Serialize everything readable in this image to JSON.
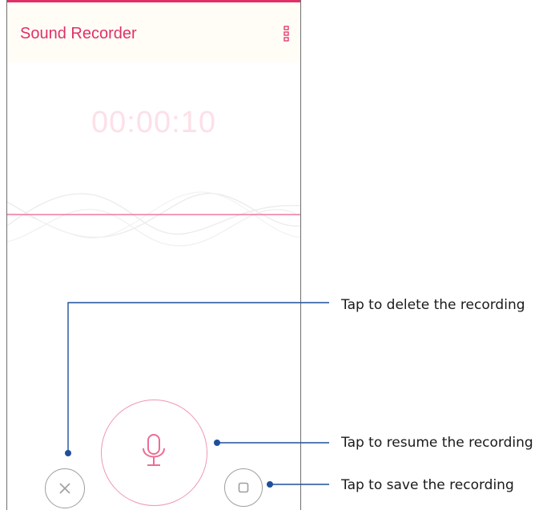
{
  "app": {
    "title": "Sound Recorder",
    "overflow_icon": "overflow-menu-icon",
    "accent_color": "#e0306a"
  },
  "recorder": {
    "elapsed_time": "00:00:10"
  },
  "controls": {
    "delete_icon": "close-icon",
    "record_icon": "microphone-icon",
    "save_icon": "stop-icon"
  },
  "callouts": {
    "delete": "Tap to delete the recording",
    "resume": "Tap to resume the recording",
    "save": "Tap to save the recording"
  }
}
